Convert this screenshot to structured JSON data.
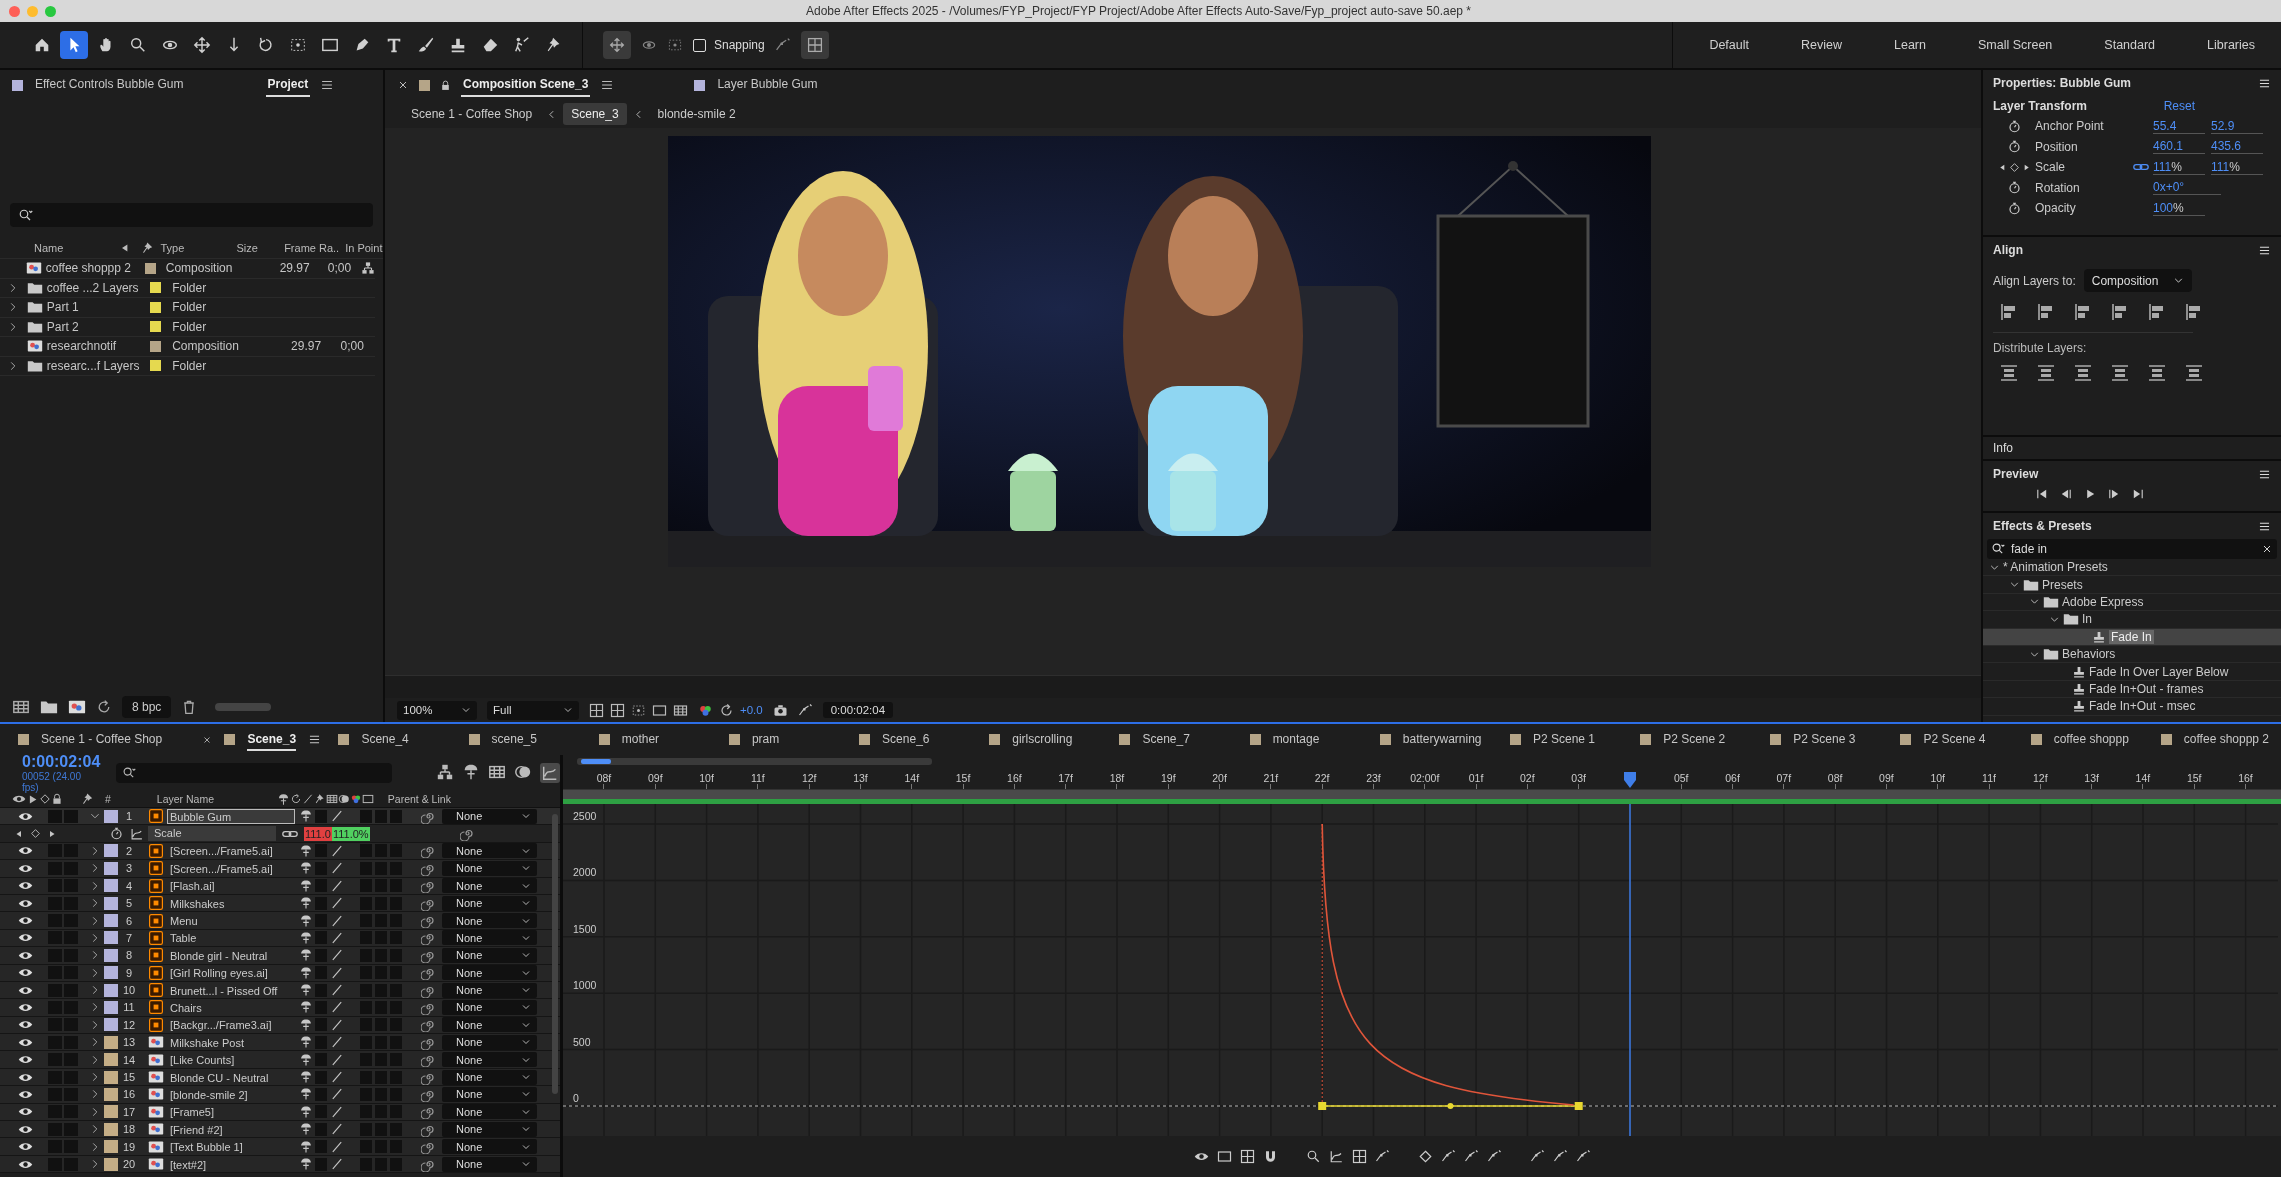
{
  "window": {
    "title": "Adobe After Effects 2025 - /Volumes/FYP_Project/FYP Project/Adobe After Effects Auto-Save/Fyp_project auto-save 50.aep *"
  },
  "toolbar": {
    "tools": [
      {
        "kind": "home",
        "selected": false
      },
      {
        "kind": "selection",
        "selected": true
      },
      {
        "kind": "hand",
        "selected": false
      },
      {
        "kind": "zoom",
        "selected": false
      },
      {
        "kind": "orbit",
        "selected": false
      },
      {
        "kind": "pan",
        "selected": false
      },
      {
        "kind": "dolly",
        "selected": false
      },
      {
        "kind": "rotate",
        "selected": false
      },
      {
        "kind": "anchor",
        "selected": false
      },
      {
        "kind": "rectangle",
        "selected": false
      },
      {
        "kind": "pen",
        "selected": false
      },
      {
        "kind": "type",
        "selected": false
      },
      {
        "kind": "brush",
        "selected": false
      },
      {
        "kind": "stamp",
        "selected": false
      },
      {
        "kind": "eraser",
        "selected": false
      },
      {
        "kind": "puppet",
        "selected": false
      },
      {
        "kind": "pin",
        "selected": false
      }
    ],
    "snapping": {
      "label": "Snapping",
      "checked": false
    },
    "workspaces": [
      {
        "label": "Default",
        "selected": false
      },
      {
        "label": "Review",
        "selected": false
      },
      {
        "label": "Learn",
        "selected": false
      },
      {
        "label": "Small Screen",
        "selected": false
      },
      {
        "label": "Standard",
        "selected": false
      },
      {
        "label": "Libraries",
        "selected": false
      }
    ]
  },
  "project_panel": {
    "tabs": [
      {
        "label": "Effect Controls Bubble Gum",
        "selected": false
      },
      {
        "label": "Project",
        "selected": true
      }
    ],
    "columns": [
      "Name",
      "Type",
      "Size",
      "Frame Ra..",
      "In Point"
    ],
    "items": [
      {
        "kind": "composition",
        "name": "coffee shoppp 2",
        "type": "Composition",
        "frame_rate": "29.97",
        "in_point": "0;00",
        "color": "#b5a588",
        "flowchart": true
      },
      {
        "kind": "folder",
        "name": "coffee ...2 Layers",
        "type": "Folder",
        "color": "#e5d94f",
        "flowchart": false
      },
      {
        "kind": "folder",
        "name": "Part 1",
        "type": "Folder",
        "color": "#e5d94f",
        "flowchart": false
      },
      {
        "kind": "folder",
        "name": "Part 2",
        "type": "Folder",
        "color": "#e5d94f",
        "flowchart": false
      },
      {
        "kind": "composition",
        "name": "researchnotif",
        "type": "Composition",
        "frame_rate": "29.97",
        "in_point": "0;00",
        "color": "#b5a588",
        "flowchart": false
      },
      {
        "kind": "folder",
        "name": "researc...f Layers",
        "type": "Folder",
        "color": "#e5d94f",
        "flowchart": false
      }
    ],
    "bit_depth": "8 bpc"
  },
  "composition_panel": {
    "tabs": [
      {
        "label": "Composition Scene_3",
        "selected": true,
        "color": "#b5a588"
      },
      {
        "label": "Layer Bubble Gum",
        "selected": false,
        "color": "#b4b4dc"
      }
    ],
    "breadcrumbs": [
      {
        "label": "Scene 1 - Coffee Shop",
        "selected": false
      },
      {
        "label": "Scene_3",
        "selected": true
      },
      {
        "label": "blonde-smile 2",
        "selected": false
      }
    ],
    "zoom": "100%",
    "resolution": "Full",
    "exposure": "+0.0",
    "timecode": "0:00:02:04"
  },
  "properties_panel": {
    "title": "Properties: Bubble Gum",
    "section": "Layer Transform",
    "reset": "Reset",
    "rows": [
      {
        "kind": "static",
        "label": "Anchor Point",
        "values": [
          {
            "value": "55.4"
          },
          {
            "value": "52.9"
          }
        ]
      },
      {
        "kind": "static",
        "label": "Position",
        "values": [
          {
            "value": "460.1"
          },
          {
            "value": "435.6"
          }
        ]
      },
      {
        "kind": "keyframed",
        "label": "Scale",
        "values": [
          {
            "value": "111",
            "unit": "%"
          },
          {
            "value": "111",
            "unit": "%"
          }
        ]
      },
      {
        "kind": "static",
        "label": "Rotation",
        "values": [
          {
            "value": "0x+0°"
          }
        ]
      },
      {
        "kind": "static",
        "label": "Opacity",
        "values": [
          {
            "value": "100",
            "unit": "%"
          }
        ]
      }
    ]
  },
  "align_panel": {
    "title": "Align",
    "align_to_label": "Align Layers to:",
    "align_to": "Composition",
    "distribute_label": "Distribute Layers:"
  },
  "info_panel": {
    "title": "Info"
  },
  "preview_panel": {
    "title": "Preview"
  },
  "effects_panel": {
    "title": "Effects & Presets",
    "search": "fade in",
    "tree": [
      {
        "kind": "category",
        "label": "* Animation Presets",
        "expanded": true,
        "children": [
          {
            "kind": "folder",
            "label": "Presets",
            "expanded": true,
            "children": [
              {
                "kind": "folder",
                "label": "Adobe Express",
                "expanded": true,
                "children": [
                  {
                    "kind": "folder",
                    "label": "In",
                    "expanded": true,
                    "children": [
                      {
                        "kind": "preset",
                        "label": "Fade In",
                        "selected": true
                      }
                    ]
                  }
                ]
              },
              {
                "kind": "folder",
                "label": "Behaviors",
                "expanded": true,
                "children": [
                  {
                    "kind": "preset",
                    "label": "Fade In Over Layer Below",
                    "selected": false
                  },
                  {
                    "kind": "preset",
                    "label": "Fade In+Out - frames",
                    "selected": false
                  },
                  {
                    "kind": "preset",
                    "label": "Fade In+Out - msec",
                    "selected": false
                  }
                ]
              }
            ]
          }
        ]
      }
    ]
  },
  "timeline": {
    "tabs": [
      {
        "label": "Scene 1 - Coffee Shop",
        "selected": false
      },
      {
        "label": "Scene_3",
        "selected": true
      },
      {
        "label": "Scene_4",
        "selected": false
      },
      {
        "label": "scene_5",
        "selected": false
      },
      {
        "label": "mother",
        "selected": false
      },
      {
        "label": "pram",
        "selected": false
      },
      {
        "label": "Scene_6",
        "selected": false
      },
      {
        "label": "girlscrolling",
        "selected": false
      },
      {
        "label": "Scene_7",
        "selected": false
      },
      {
        "label": "montage",
        "selected": false
      },
      {
        "label": "batterywarning",
        "selected": false
      },
      {
        "label": "P2 Scene 1",
        "selected": false
      },
      {
        "label": "P2 Scene 2",
        "selected": false
      },
      {
        "label": "P2 Scene 3",
        "selected": false
      },
      {
        "label": "P2 Scene 4",
        "selected": false
      },
      {
        "label": "coffee shoppp",
        "selected": false
      },
      {
        "label": "coffee shoppp 2",
        "selected": false
      }
    ],
    "timecode": "0:00:02:04",
    "frame_info": "00052 (24.00 fps)",
    "graph_editor_on": true,
    "columns": {
      "number": "#",
      "name": "Layer Name",
      "parent": "Parent & Link"
    },
    "layers": [
      {
        "kind": "ai",
        "number": "1",
        "name": "Bubble Gum",
        "color": "#b4b4dc",
        "visible": true,
        "expanded": true,
        "selected": true,
        "parent": "None",
        "property": {
          "name": "Scale",
          "values": [
            "111.0",
            "111.0%"
          ]
        }
      },
      {
        "kind": "ai",
        "number": "2",
        "name": "[Screen.../Frame5.ai]",
        "color": "#b4b4dc",
        "visible": true,
        "expanded": false,
        "selected": false,
        "parent": "None"
      },
      {
        "kind": "ai",
        "number": "3",
        "name": "[Screen.../Frame5.ai]",
        "color": "#b4b4dc",
        "visible": true,
        "expanded": false,
        "selected": false,
        "parent": "None"
      },
      {
        "kind": "ai",
        "number": "4",
        "name": "[Flash.ai]",
        "color": "#b4b4dc",
        "visible": true,
        "expanded": false,
        "selected": false,
        "parent": "None"
      },
      {
        "kind": "ai",
        "number": "5",
        "name": "Milkshakes",
        "color": "#b4b4dc",
        "visible": true,
        "expanded": false,
        "selected": false,
        "parent": "None"
      },
      {
        "kind": "ai",
        "number": "6",
        "name": "Menu",
        "color": "#b4b4dc",
        "visible": true,
        "expanded": false,
        "selected": false,
        "parent": "None"
      },
      {
        "kind": "ai",
        "number": "7",
        "name": "Table",
        "color": "#b4b4dc",
        "visible": true,
        "expanded": false,
        "selected": false,
        "parent": "None"
      },
      {
        "kind": "ai",
        "number": "8",
        "name": "Blonde girl - Neutral",
        "color": "#b4b4dc",
        "visible": true,
        "expanded": false,
        "selected": false,
        "parent": "None"
      },
      {
        "kind": "ai",
        "number": "9",
        "name": "[Girl Rolling eyes.ai]",
        "color": "#b4b4dc",
        "visible": true,
        "expanded": false,
        "selected": false,
        "parent": "None"
      },
      {
        "kind": "ai",
        "number": "10",
        "name": "Brunett...l - Pissed Off",
        "color": "#b4b4dc",
        "visible": true,
        "expanded": false,
        "selected": false,
        "parent": "None"
      },
      {
        "kind": "ai",
        "number": "11",
        "name": "Chairs",
        "color": "#b4b4dc",
        "visible": true,
        "expanded": false,
        "selected": false,
        "parent": "None"
      },
      {
        "kind": "ai",
        "number": "12",
        "name": "[Backgr.../Frame3.ai]",
        "color": "#b4b4dc",
        "visible": true,
        "expanded": false,
        "selected": false,
        "parent": "None"
      },
      {
        "kind": "comp",
        "number": "13",
        "name": "Milkshake Post",
        "color": "#c4ad86",
        "visible": true,
        "expanded": false,
        "selected": false,
        "parent": "None"
      },
      {
        "kind": "comp",
        "number": "14",
        "name": "[Like Counts]",
        "color": "#c4ad86",
        "visible": true,
        "expanded": false,
        "selected": false,
        "parent": "None"
      },
      {
        "kind": "comp",
        "number": "15",
        "name": "Blonde CU - Neutral",
        "color": "#c4ad86",
        "visible": true,
        "expanded": false,
        "selected": false,
        "parent": "None"
      },
      {
        "kind": "comp",
        "number": "16",
        "name": "[blonde-smile 2]",
        "color": "#c4ad86",
        "visible": true,
        "expanded": false,
        "selected": false,
        "parent": "None"
      },
      {
        "kind": "comp",
        "number": "17",
        "name": "[Frame5]",
        "color": "#c4ad86",
        "visible": true,
        "expanded": false,
        "selected": false,
        "parent": "None"
      },
      {
        "kind": "comp",
        "number": "18",
        "name": "[Friend #2]",
        "color": "#c4ad86",
        "visible": true,
        "expanded": false,
        "selected": false,
        "parent": "None"
      },
      {
        "kind": "comp",
        "number": "19",
        "name": "[Text Bubble 1]",
        "color": "#c4ad86",
        "visible": true,
        "expanded": false,
        "selected": false,
        "parent": "None"
      },
      {
        "kind": "comp",
        "number": "20",
        "name": "[text#2]",
        "color": "#c4ad86",
        "visible": true,
        "expanded": false,
        "selected": false,
        "parent": "None"
      }
    ],
    "ruler": [
      {
        "kind": "tick",
        "label": "08f"
      },
      {
        "kind": "tick",
        "label": "09f"
      },
      {
        "kind": "tick",
        "label": "10f"
      },
      {
        "kind": "tick",
        "label": "11f"
      },
      {
        "kind": "tick",
        "label": "12f"
      },
      {
        "kind": "tick",
        "label": "13f"
      },
      {
        "kind": "tick",
        "label": "14f"
      },
      {
        "kind": "tick",
        "label": "15f"
      },
      {
        "kind": "tick",
        "label": "16f"
      },
      {
        "kind": "tick",
        "label": "17f"
      },
      {
        "kind": "tick",
        "label": "18f"
      },
      {
        "kind": "tick",
        "label": "19f"
      },
      {
        "kind": "tick",
        "label": "20f"
      },
      {
        "kind": "tick",
        "label": "21f"
      },
      {
        "kind": "tick",
        "label": "22f"
      },
      {
        "kind": "tick",
        "label": "23f"
      },
      {
        "kind": "tick",
        "label": "02:00f"
      },
      {
        "kind": "tick",
        "label": "01f"
      },
      {
        "kind": "tick",
        "label": "02f"
      },
      {
        "kind": "tick",
        "label": "03f"
      },
      {
        "kind": "playhead"
      },
      {
        "kind": "tick",
        "label": "05f"
      },
      {
        "kind": "tick",
        "label": "06f"
      },
      {
        "kind": "tick",
        "label": "07f"
      },
      {
        "kind": "tick",
        "label": "08f"
      },
      {
        "kind": "tick",
        "label": "09f"
      },
      {
        "kind": "tick",
        "label": "10f"
      },
      {
        "kind": "tick",
        "label": "11f"
      },
      {
        "kind": "tick",
        "label": "12f"
      },
      {
        "kind": "tick",
        "label": "13f"
      },
      {
        "kind": "tick",
        "label": "14f"
      },
      {
        "kind": "tick",
        "label": "15f"
      },
      {
        "kind": "tick",
        "label": "16f"
      }
    ],
    "graph_labels": [
      "2500",
      "2000",
      "1500",
      "1000",
      "500",
      "0"
    ]
  }
}
